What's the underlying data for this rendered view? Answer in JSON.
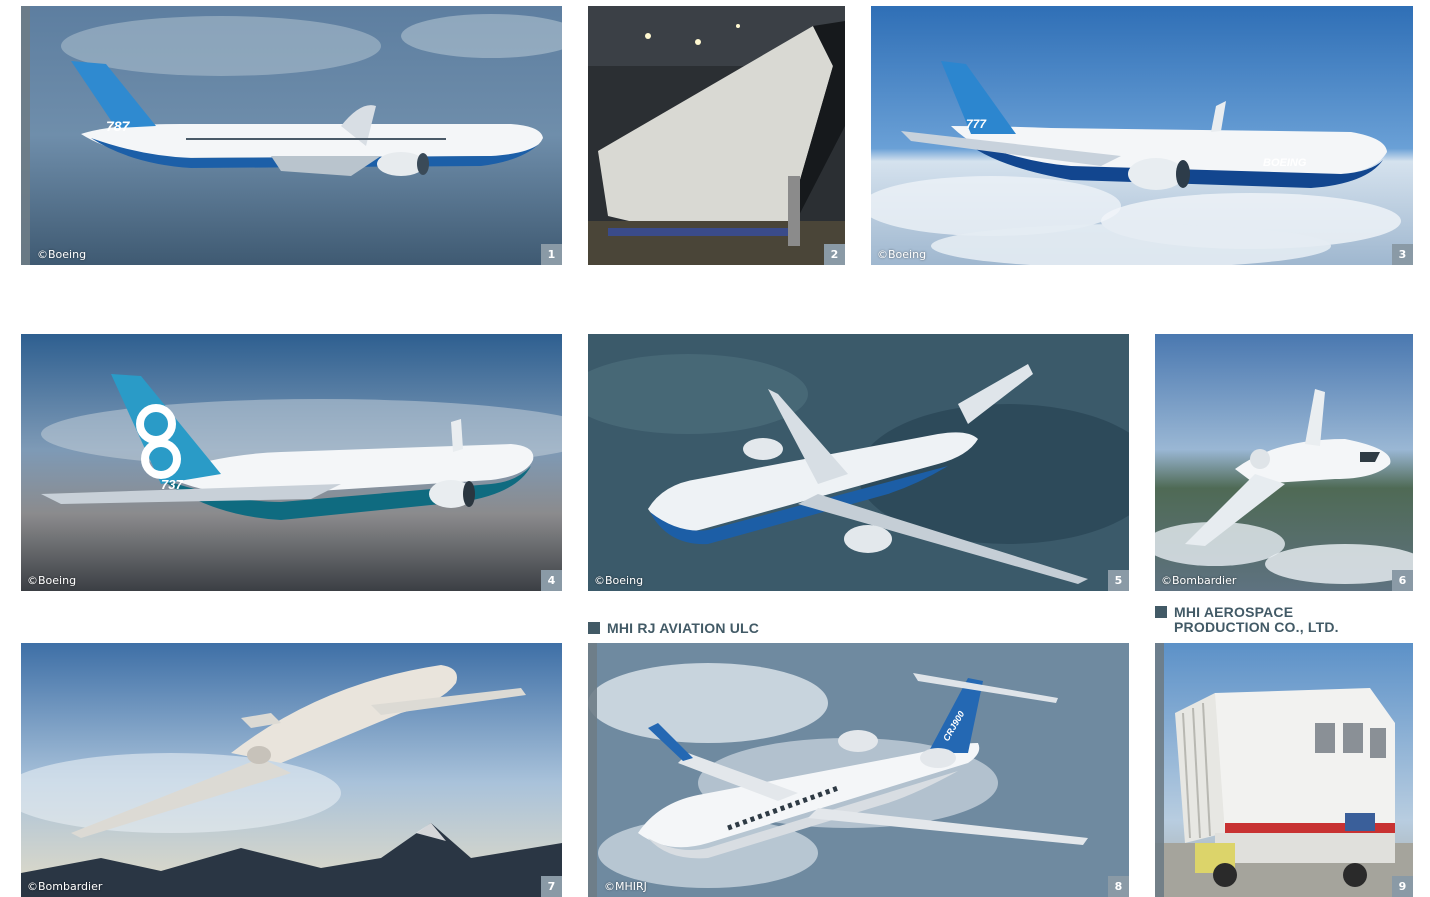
{
  "photos": [
    {
      "number": "1",
      "credit": "©Boeing",
      "subject": "787-10 airliner in flight",
      "tail_text": "787"
    },
    {
      "number": "2",
      "credit": "",
      "subject": "Aircraft tail structure in hangar"
    },
    {
      "number": "3",
      "credit": "©Boeing",
      "subject": "777-9 airliner in flight",
      "tail_text": "777",
      "fuselage_text": "BOEING"
    },
    {
      "number": "4",
      "credit": "©Boeing",
      "subject": "737 MAX 8 airliner in flight",
      "tail_text": "737"
    },
    {
      "number": "5",
      "credit": "©Boeing",
      "subject": "767 airliner over water"
    },
    {
      "number": "6",
      "credit": "©Bombardier",
      "subject": "Business jet over coastline"
    },
    {
      "number": "7",
      "credit": "©Bombardier",
      "subject": "Business jet climbing over mountains"
    },
    {
      "number": "8",
      "credit": "©MHIRJ",
      "subject": "CRJ900 regional jet above clouds",
      "tail_text": "CRJ900"
    },
    {
      "number": "9",
      "credit": "",
      "subject": "Passenger boarding stair truck"
    }
  ],
  "sections": {
    "mhi_rj": {
      "label": "MHI RJ AVIATION ULC"
    },
    "mhi_aerospace": {
      "label": "MHI AEROSPACE\nPRODUCTION CO., LTD."
    }
  },
  "colors": {
    "label_accent": "#425a66",
    "number_badge": "#8a9aa6"
  }
}
